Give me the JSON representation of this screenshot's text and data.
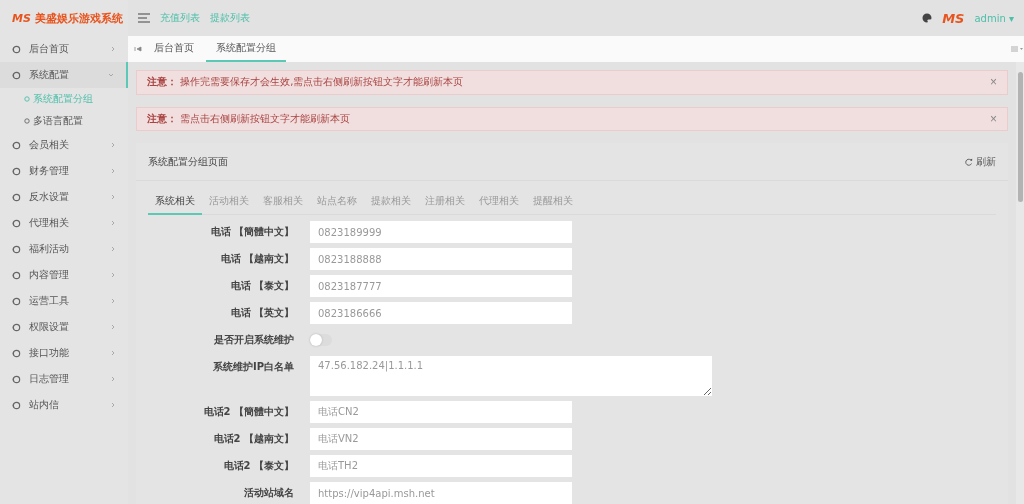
{
  "brand": {
    "logo": "MS",
    "name": "美盛娱乐游戏系统"
  },
  "header": {
    "links": [
      "充值列表",
      "提款列表"
    ],
    "user": "admin",
    "user_caret": "▾",
    "logo": "MS"
  },
  "sidebar": {
    "items": [
      {
        "label": "后台首页",
        "expanded": false
      },
      {
        "label": "系统配置",
        "expanded": true,
        "children": [
          {
            "label": "系统配置分组",
            "selected": true
          },
          {
            "label": "多语言配置",
            "selected": false
          }
        ]
      },
      {
        "label": "会员相关",
        "expanded": false
      },
      {
        "label": "财务管理",
        "expanded": false
      },
      {
        "label": "反水设置",
        "expanded": false
      },
      {
        "label": "代理相关",
        "expanded": false
      },
      {
        "label": "福利活动",
        "expanded": false
      },
      {
        "label": "内容管理",
        "expanded": false
      },
      {
        "label": "运营工具",
        "expanded": false
      },
      {
        "label": "权限设置",
        "expanded": false
      },
      {
        "label": "接口功能",
        "expanded": false
      },
      {
        "label": "日志管理",
        "expanded": false
      },
      {
        "label": "站内信",
        "expanded": false
      }
    ]
  },
  "page_tabs": [
    {
      "label": "后台首页",
      "selected": false
    },
    {
      "label": "系统配置分组",
      "selected": true
    }
  ],
  "alerts": [
    {
      "title": "注意：",
      "text": "操作完需要保存才会生效,需点击右侧刷新按钮文字才能刷新本页",
      "close": "×"
    },
    {
      "title": "注意：",
      "text": "需点击右侧刷新按钮文字才能刷新本页",
      "close": "×"
    }
  ],
  "card": {
    "title": "系统配置分组页面",
    "refresh": "刷新",
    "tabs": [
      {
        "label": "系统相关",
        "selected": true
      },
      {
        "label": "活动相关",
        "selected": false
      },
      {
        "label": "客服相关",
        "selected": false
      },
      {
        "label": "站点名称",
        "selected": false
      },
      {
        "label": "提款相关",
        "selected": false
      },
      {
        "label": "注册相关",
        "selected": false
      },
      {
        "label": "代理相关",
        "selected": false
      },
      {
        "label": "提醒相关",
        "selected": false
      }
    ],
    "fields": [
      {
        "kind": "text",
        "label": "电话 【簡體中文】",
        "value": "0823189999"
      },
      {
        "kind": "text",
        "label": "电话 【越南文】",
        "value": "0823188888"
      },
      {
        "kind": "text",
        "label": "电话 【泰文】",
        "value": "0823187777"
      },
      {
        "kind": "text",
        "label": "电话 【英文】",
        "value": "0823186666"
      },
      {
        "kind": "switch",
        "label": "是否开启系统维护",
        "on": false
      },
      {
        "kind": "textarea",
        "label": "系统维护IP白名单",
        "value": "47.56.182.24|1.1.1.1"
      },
      {
        "kind": "text",
        "label": "电话2 【簡體中文】",
        "value": "电话CN2"
      },
      {
        "kind": "text",
        "label": "电话2 【越南文】",
        "value": "电话VN2"
      },
      {
        "kind": "text",
        "label": "电话2 【泰文】",
        "value": "电话TH2"
      },
      {
        "kind": "text",
        "label": "活动站域名",
        "value": "https://vip4api.msh.net"
      }
    ]
  }
}
